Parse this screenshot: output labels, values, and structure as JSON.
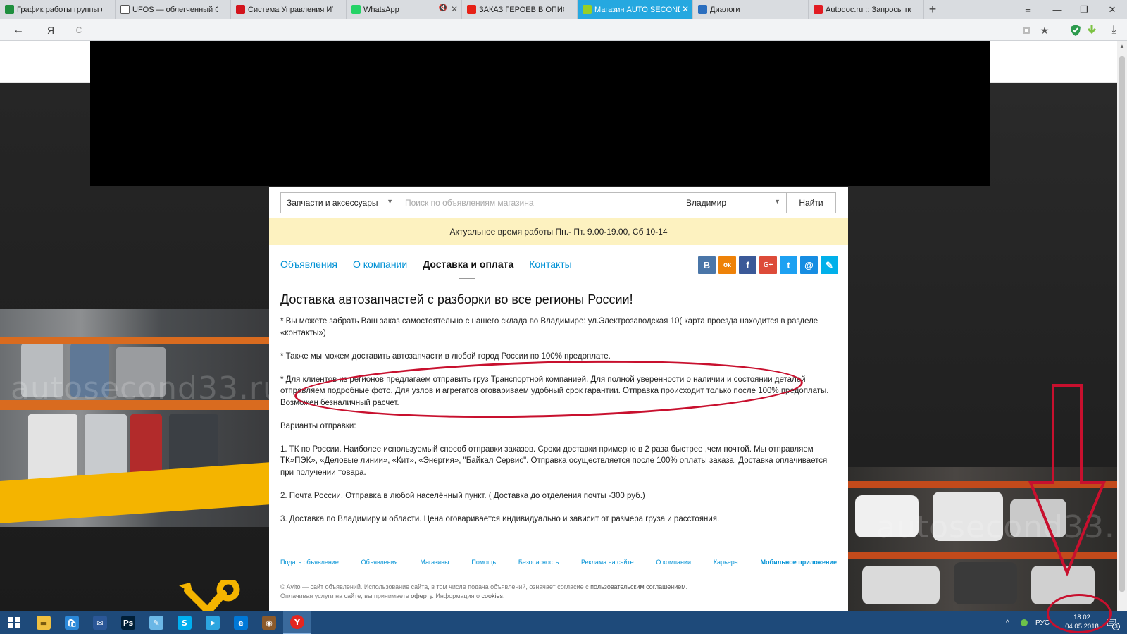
{
  "browser": {
    "tabs": [
      {
        "label": "График работы группы со",
        "icon": "sheets-icon",
        "color": "#1f8f3e"
      },
      {
        "label": "UFOS — облегченный Outl",
        "icon": "document-icon",
        "color": "#ffffff"
      },
      {
        "label": "Система Управления ИТ",
        "icon": "red-square-icon",
        "color": "#d3141c"
      },
      {
        "label": "WhatsApp",
        "icon": "whatsapp-icon",
        "color": "#25d366"
      },
      {
        "label": "ЗАКАЗ ГЕРОЕВ В ОПИСАНИ",
        "icon": "youtube-icon",
        "color": "#e62117"
      },
      {
        "label": "Магазин AUTO SECOND",
        "icon": "avito-icon",
        "color": "#97cf26"
      },
      {
        "label": "Диалоги",
        "icon": "chat-icon",
        "color": "#2c6fbf"
      },
      {
        "label": "Autodoc.ru :: Запросы по VI",
        "icon": "autodoc-icon",
        "color": "#e11b22"
      }
    ],
    "new_tab_label": "+",
    "back_label": "←",
    "yandex_label": "Я",
    "reload_label": "C",
    "window_controls": {
      "menu": "≡",
      "minimize": "—",
      "restore": "❐",
      "close": "✕"
    },
    "star_label": "★",
    "download_label": "⤓"
  },
  "shop": {
    "search": {
      "category": "Запчасти и аксессуары",
      "placeholder": "Поиск по объявлениям магазина",
      "city": "Владимир",
      "button": "Найти"
    },
    "hours_banner": "Актуальное время работы Пн.- Пт. 9.00-19.00, Сб 10-14",
    "nav": [
      {
        "label": "Объявления",
        "active": false
      },
      {
        "label": "О компании",
        "active": false
      },
      {
        "label": "Доставка и оплата",
        "active": true
      },
      {
        "label": "Контакты",
        "active": false
      }
    ],
    "social": [
      {
        "icon": "vk-icon",
        "glyph": "В",
        "color": "#4a76a8"
      },
      {
        "icon": "odnoklassniki-icon",
        "glyph": "ок",
        "color": "#ee8208"
      },
      {
        "icon": "facebook-icon",
        "glyph": "f",
        "color": "#3b5998"
      },
      {
        "icon": "google-plus-icon",
        "glyph": "G+",
        "color": "#dd4b39"
      },
      {
        "icon": "twitter-icon",
        "glyph": "t",
        "color": "#1da1f2"
      },
      {
        "icon": "mail-ru-icon",
        "glyph": "@",
        "color": "#168de2"
      },
      {
        "icon": "livejournal-icon",
        "glyph": "✎",
        "color": "#00b0ea"
      }
    ],
    "article": {
      "title": "Доставка автозапчастей с разборки во все регионы России!",
      "paragraphs": [
        "* Вы можете забрать Ваш заказ самостоятельно с нашего склада во Владимире: ул.Электрозаводская 10( карта проезда находится в разделе «контакты»)",
        "* Также мы можем доставить автозапчасти в любой город России по 100% предоплате.",
        "* Для клиентов из регионов предлагаем отправить груз Транспортной компанией. Для полной уверенности о наличии и состоянии деталей отправляем подробные фото. Для узлов и агрегатов оговариваем удобный срок гарантии. Отправка происходит только после 100% предоплаты. Возможен безналичный расчет.",
        "Варианты отправки:",
        "1. ТК по России. Наиболее используемый способ отправки заказов. Сроки доставки примерно в 2 раза быстрее ,чем почтой. Мы отправляем ТК»ПЭК», «Деловые линии», «Кит», «Энергия», \"Байкал Сервис\". Отправка осуществляется после 100% оплаты заказа. Доставка оплачивается при получении товара.",
        "2. Почта России. Отправка в любой населённый пункт. ( Доставка до отделения почты -300 руб.)",
        "3. Доставка по Владимиру и области. Цена оговаривается индивидуально и зависит от размера груза и расстояния."
      ]
    },
    "footer": {
      "links": [
        {
          "label": "Подать объявление",
          "strong": false
        },
        {
          "label": "Объявления",
          "strong": false
        },
        {
          "label": "Магазины",
          "strong": false
        },
        {
          "label": "Помощь",
          "strong": false
        },
        {
          "label": "Безопасность",
          "strong": false
        },
        {
          "label": "Реклама на сайте",
          "strong": false
        },
        {
          "label": "О компании",
          "strong": false
        },
        {
          "label": "Карьера",
          "strong": false
        },
        {
          "label": "Мобильное приложение",
          "strong": true
        }
      ],
      "legal_line1_prefix": "© Avito — сайт объявлений. Использование сайта, в том числе подача объявлений, означает согласие с ",
      "legal_line1_link": "пользовательским соглашением",
      "legal_line1_suffix": ".",
      "legal_line2_prefix": "Оплачивая услуги на сайте, вы принимаете ",
      "legal_line2_link1": "оферту",
      "legal_line2_mid": ". Информация о ",
      "legal_line2_link2": "cookies",
      "legal_line2_suffix": "."
    }
  },
  "background": {
    "watermark": "autosecond33.ru"
  },
  "annotation": {
    "color": "#c8102e"
  },
  "taskbar": {
    "apps": [
      {
        "icon": "file-explorer-icon",
        "glyph": "▬",
        "color": "#f0c040"
      },
      {
        "icon": "store-icon",
        "glyph": "🛍",
        "color": "#2b88d8"
      },
      {
        "icon": "mail-icon",
        "glyph": "✉",
        "color": "#2b5797"
      },
      {
        "icon": "photoshop-icon",
        "glyph": "Ps",
        "color": "#001e36"
      },
      {
        "icon": "notepad-icon",
        "glyph": "✎",
        "color": "#6bb7e6"
      },
      {
        "icon": "skype-icon",
        "glyph": "S",
        "color": "#00aff0"
      },
      {
        "icon": "telegram-icon",
        "glyph": "➤",
        "color": "#2ca5e0"
      },
      {
        "icon": "edge-icon",
        "glyph": "e",
        "color": "#0078d7"
      },
      {
        "icon": "app-icon",
        "glyph": "◉",
        "color": "#8b5a2b"
      },
      {
        "icon": "yandex-browser-icon",
        "glyph": "Y",
        "color": "#e52620"
      }
    ],
    "tray": {
      "chevron": "^",
      "language": "РУС"
    },
    "clock": {
      "time": "18:02",
      "date": "04.05.2018"
    },
    "notifications_count": "3"
  }
}
